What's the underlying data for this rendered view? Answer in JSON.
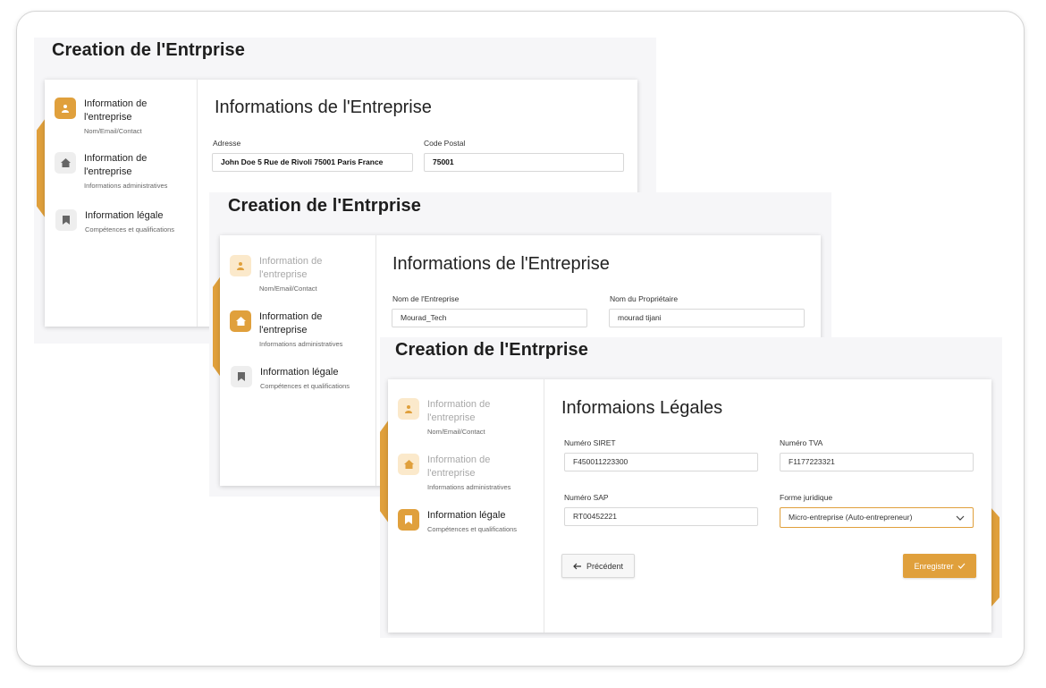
{
  "screen_title": "Creation de l'Entrprise",
  "colors": {
    "accent": "#e0a03c",
    "accent_light": "#fbe9cb",
    "idle": "#eeeeee"
  },
  "steps": [
    {
      "title": "Information de l'entreprise",
      "subtitle": "Nom/Email/Contact",
      "icon": "user-icon"
    },
    {
      "title": "Information de l'entreprise",
      "subtitle": "Informations administratives",
      "icon": "home-icon"
    },
    {
      "title": "Information légale",
      "subtitle": "Compétences et qualifications",
      "icon": "bookmark-icon"
    }
  ],
  "screen1": {
    "form_title": "Informations de l'Entreprise",
    "adresse_label": "Adresse",
    "adresse_value": "John Doe 5 Rue de Rivoli 75001 Paris France",
    "code_postal_label": "Code Postal",
    "code_postal_value": "75001"
  },
  "screen2": {
    "form_title": "Informations de l'Entreprise",
    "nom_entreprise_label": "Nom de l'Entreprise",
    "nom_entreprise_value": "Mourad_Tech",
    "nom_proprietaire_label": "Nom du Propriétaire",
    "nom_proprietaire_value": "mourad tijani"
  },
  "screen3": {
    "form_title": "Informaions Légales",
    "siret_label": "Numéro SIRET",
    "siret_value": "F450011223300",
    "tva_label": "Numéro TVA",
    "tva_value": "F1177223321",
    "sap_label": "Numéro SAP",
    "sap_value": "RT00452221",
    "forme_label": "Forme juridique",
    "forme_value": "Micro-entreprise (Auto-entrepreneur)",
    "prev_label": "Précédent",
    "save_label": "Enregistrer"
  }
}
